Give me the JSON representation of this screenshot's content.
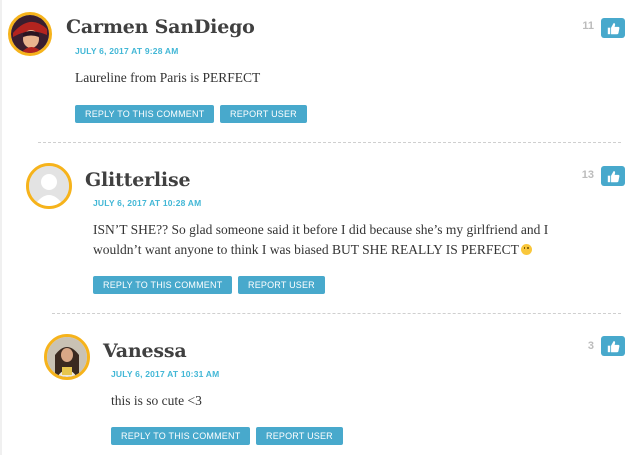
{
  "comments": [
    {
      "author": "Carmen SanDiego",
      "date": "JULY 6, 2017 AT 9:28 AM",
      "text": "Laureline from Paris is PERFECT",
      "reply_label": "REPLY TO THIS COMMENT",
      "report_label": "REPORT USER",
      "likes": "11"
    },
    {
      "author": "Glitterlise",
      "date": "JULY 6, 2017 AT 10:28 AM",
      "text_line1": "ISN’T SHE?? So glad someone said it before I did because she’s my girlfriend and I",
      "text_line2": "wouldn’t want anyone to think I was biased BUT SHE REALLY IS PERFECT",
      "reply_label": "REPLY TO THIS COMMENT",
      "report_label": "REPORT USER",
      "likes": "13"
    },
    {
      "author": "Vanessa",
      "date": "JULY 6, 2017 AT 10:31 AM",
      "text": "this is so cute <3",
      "reply_label": "REPLY TO THIS COMMENT",
      "report_label": "REPORT USER",
      "likes": "3"
    }
  ],
  "icons": {
    "like": "thumbs-up-icon",
    "emoji": "smiley-emoji-icon"
  },
  "colors": {
    "accent": "#48a9cc",
    "date": "#42b7d6",
    "avatar_border": "#f6b31b"
  }
}
